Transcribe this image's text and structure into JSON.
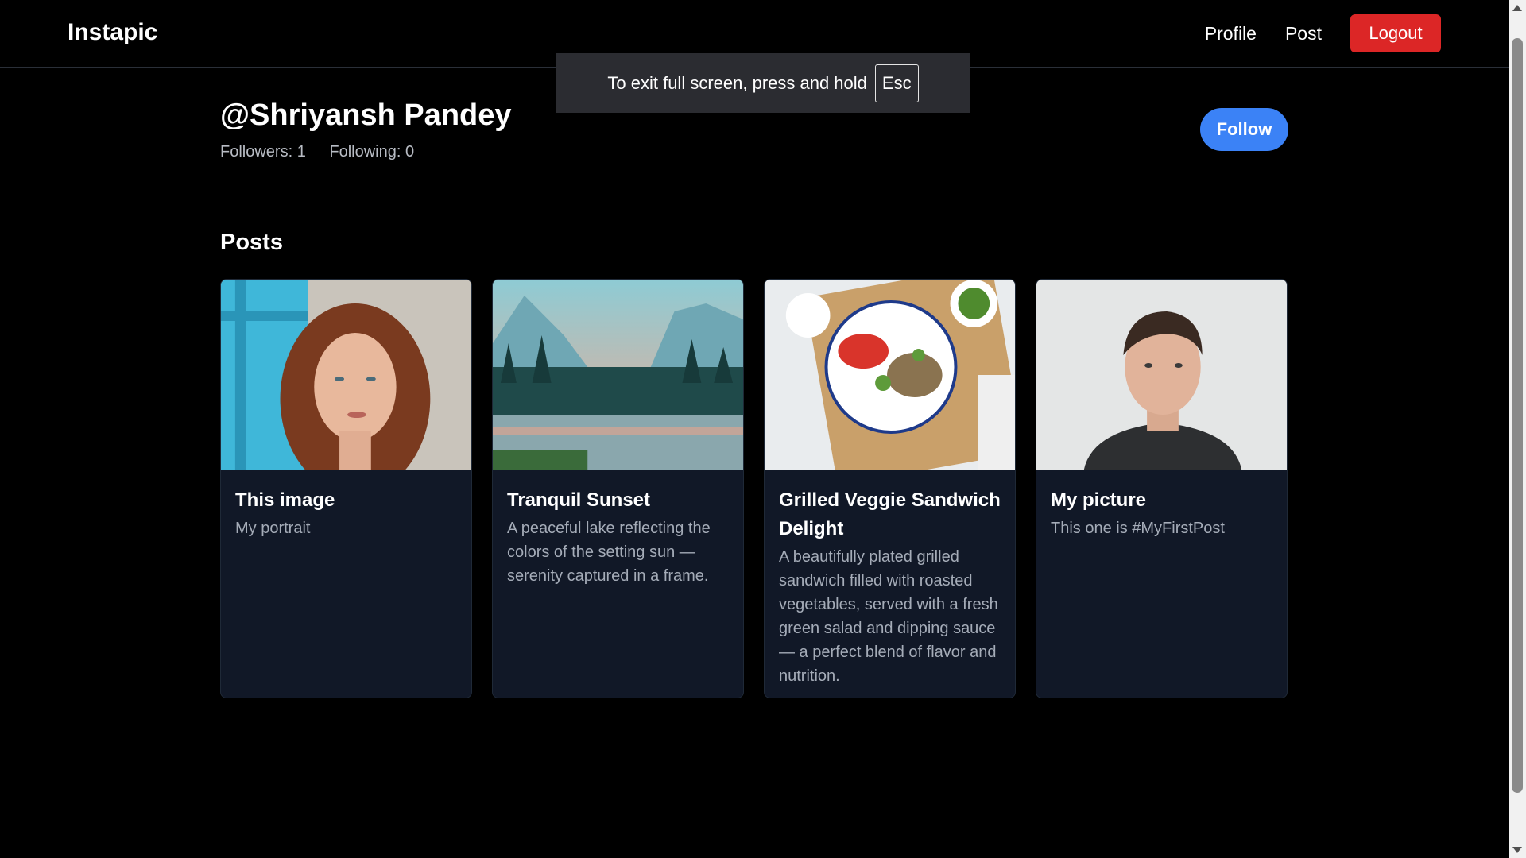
{
  "navbar": {
    "brand": "Instapic",
    "links": [
      "Profile",
      "Post"
    ],
    "logout_label": "Logout"
  },
  "fullscreen_toast": {
    "message": "To exit full screen, press and hold",
    "key": "Esc"
  },
  "profile": {
    "username": "@Shriyansh Pandey",
    "followers": "Followers: 1",
    "following": "Following: 0",
    "follow_label": "Follow"
  },
  "posts_heading": "Posts",
  "posts": [
    {
      "title": "This image",
      "description": "My portrait",
      "image": "portrait-woman"
    },
    {
      "title": "Tranquil Sunset",
      "description": "A peaceful lake reflecting the colors of the setting sun — serenity captured in a frame.",
      "image": "lake-sunset"
    },
    {
      "title": "Grilled Veggie Sandwich Delight",
      "description": "A beautifully plated grilled sandwich filled with roasted vegetables, served with a fresh green salad and dipping sauce — a perfect blend of flavor and nutrition.",
      "image": "food-plate"
    },
    {
      "title": "My picture",
      "description": "This one is #MyFirstPost",
      "image": "portrait-man"
    }
  ],
  "colors": {
    "background": "#000000",
    "card_background": "#111827",
    "follow_button": "#3b82f6",
    "logout_button": "#dc2626"
  }
}
